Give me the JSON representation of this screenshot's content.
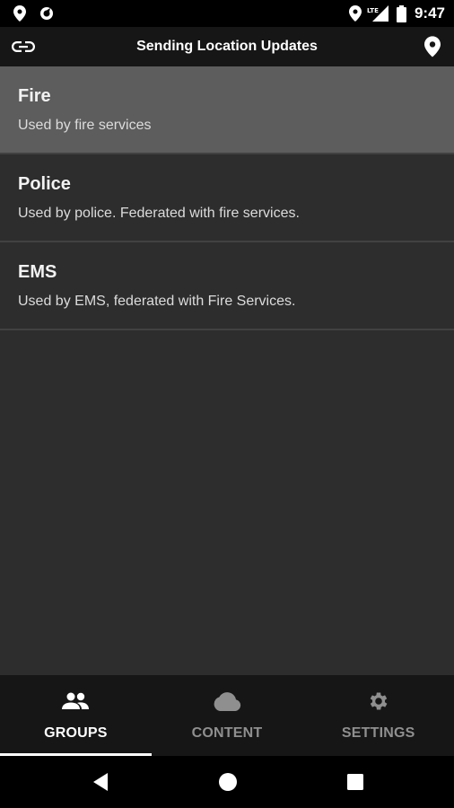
{
  "status_bar": {
    "time": "9:47",
    "network_label": "LTE",
    "icons": [
      "location-pin-icon",
      "sync-icon",
      "location-pin-icon",
      "signal-icon",
      "battery-icon"
    ]
  },
  "app_bar": {
    "title": "Sending Location Updates",
    "left_icon": "link-icon",
    "right_icon": "location-pin-icon"
  },
  "groups": [
    {
      "name": "Fire",
      "description": "Used by fire services",
      "selected": true
    },
    {
      "name": "Police",
      "description": "Used by police. Federated with fire services.",
      "selected": false
    },
    {
      "name": "EMS",
      "description": "Used by EMS, federated with Fire Services.",
      "selected": false
    }
  ],
  "bottom_nav": {
    "tabs": [
      {
        "label": "GROUPS",
        "icon": "people-icon",
        "active": true
      },
      {
        "label": "CONTENT",
        "icon": "cloud-icon",
        "active": false
      },
      {
        "label": "SETTINGS",
        "icon": "gear-icon",
        "active": false
      }
    ]
  },
  "system_nav": {
    "buttons": [
      "back-icon",
      "home-icon",
      "recents-icon"
    ]
  },
  "colors": {
    "background": "#2d2d2d",
    "selected_row": "#5d5d5d",
    "bar": "#161616",
    "inactive_label": "#8f8f8f"
  }
}
